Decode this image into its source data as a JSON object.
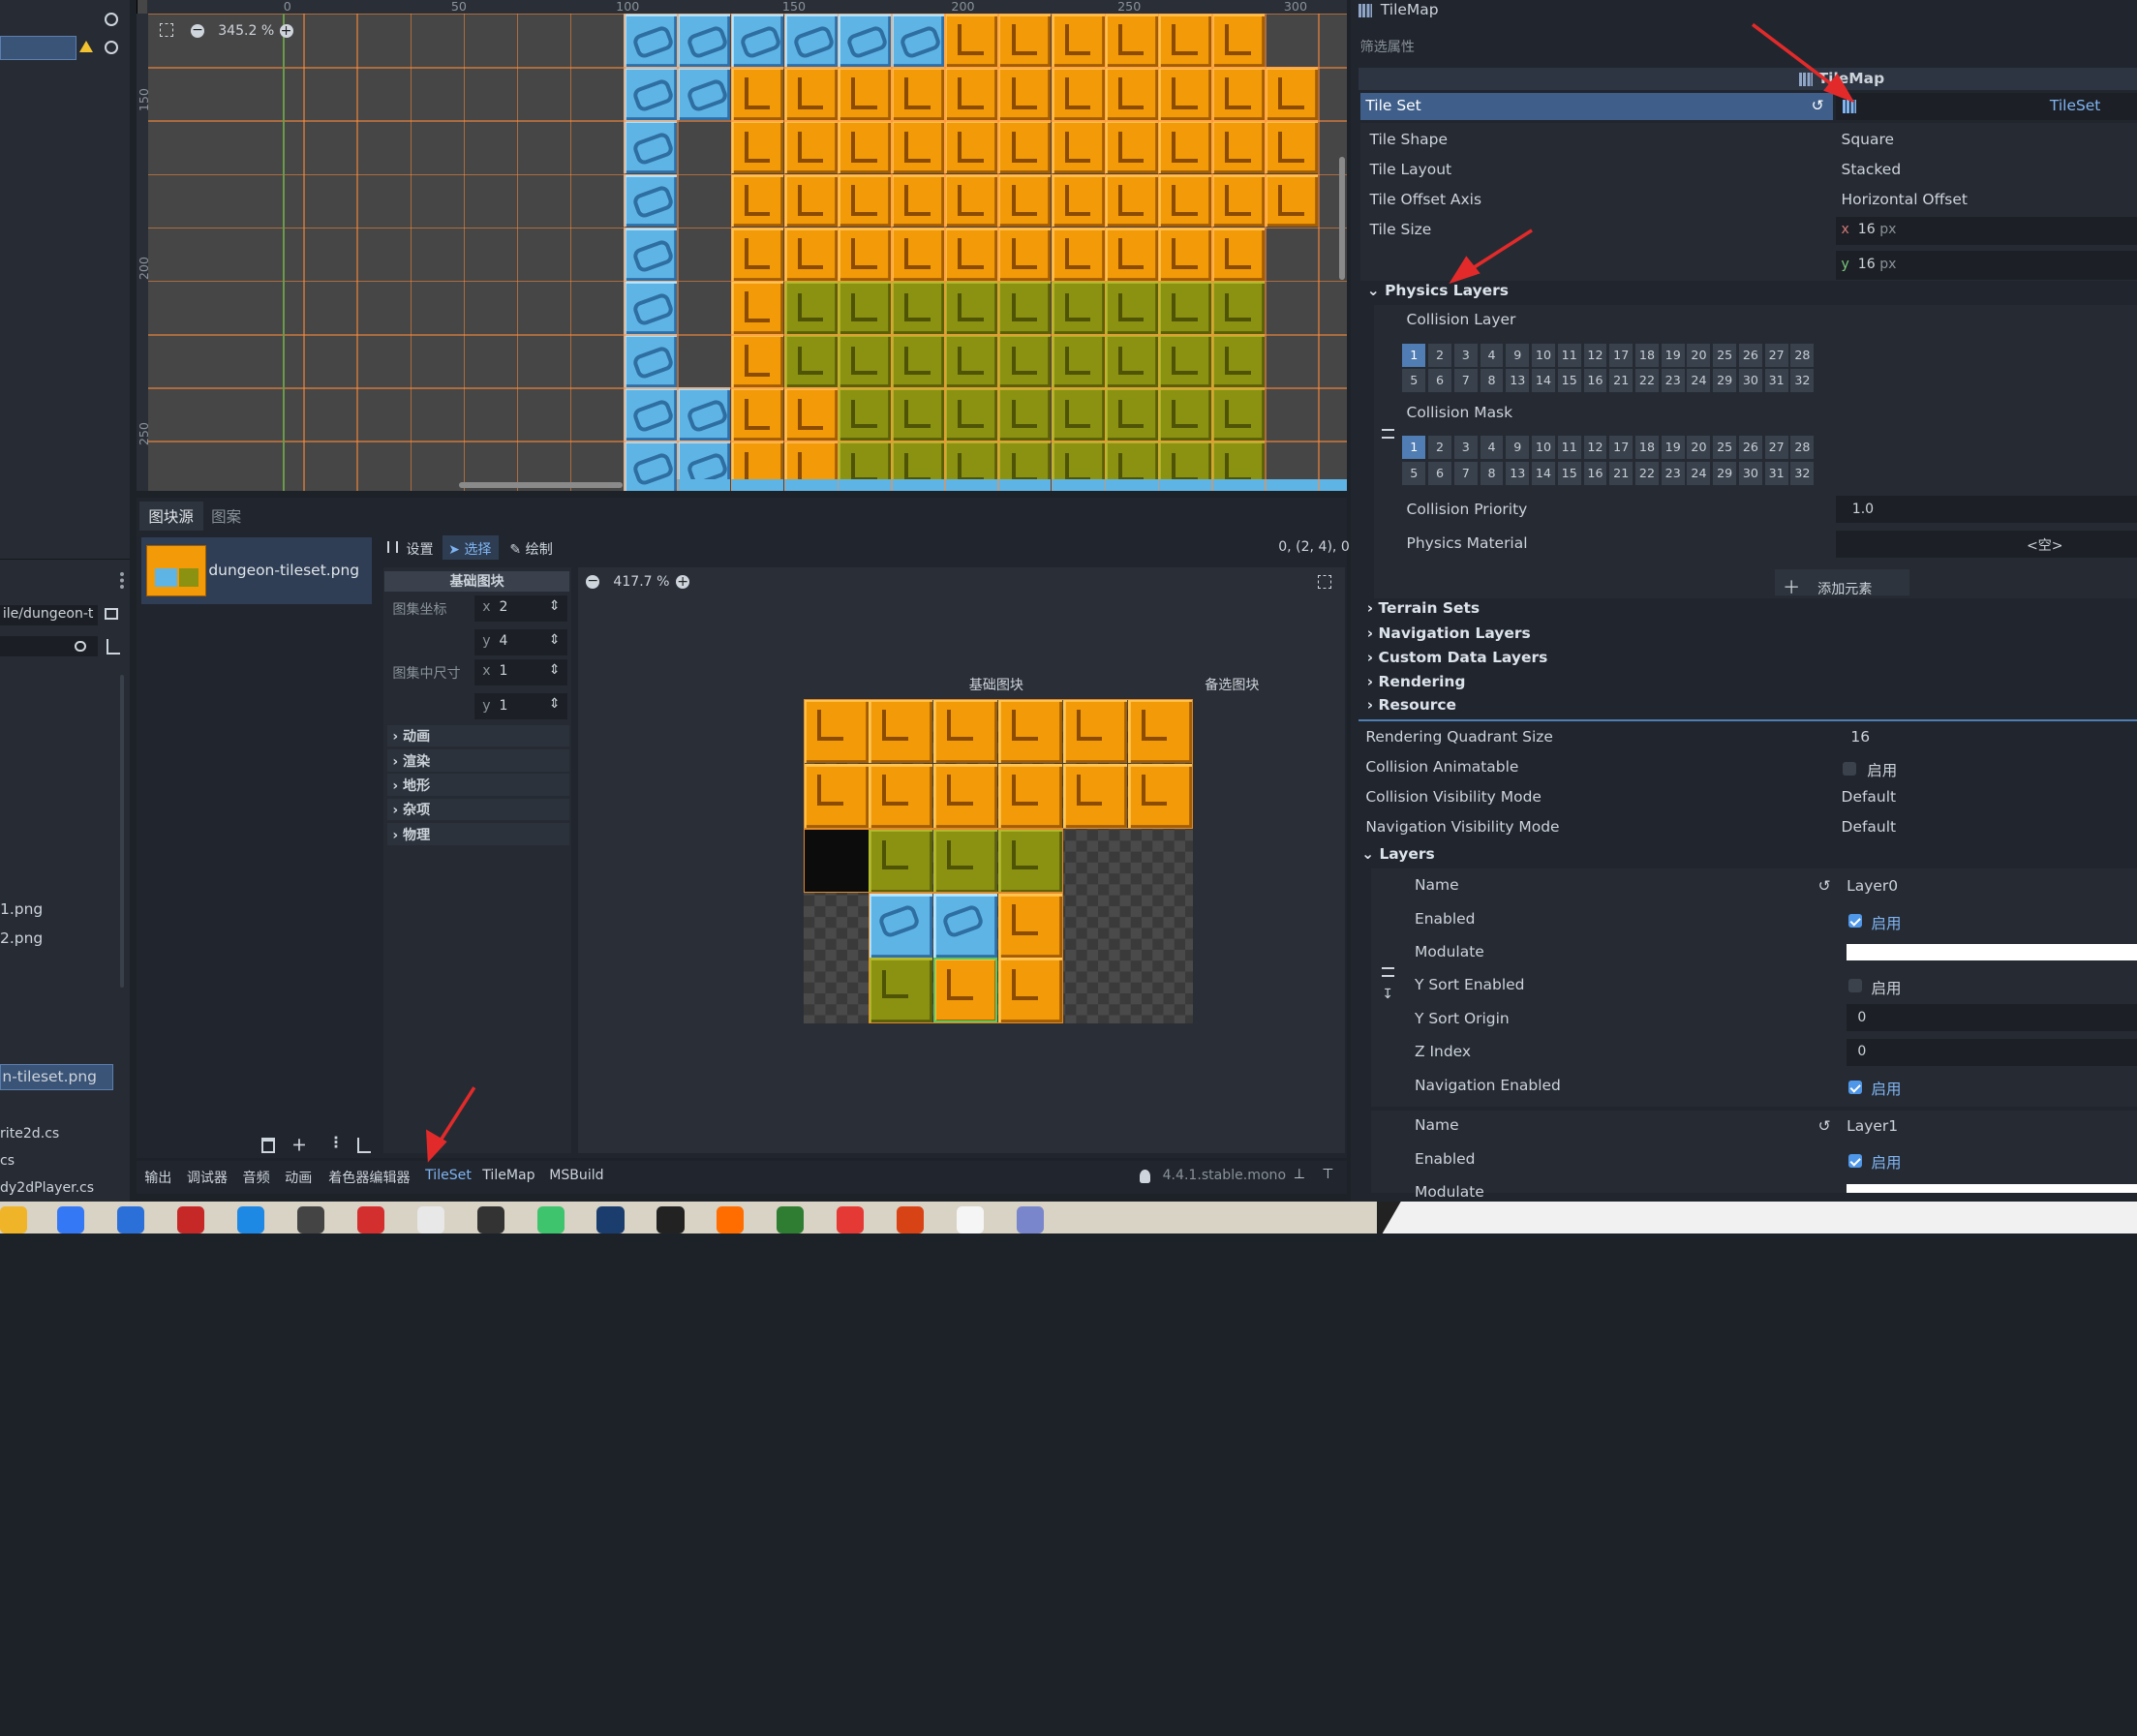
{
  "viewport": {
    "zoom": "345.2 %",
    "ruler_ticks": [
      "0",
      "50",
      "100",
      "150",
      "200",
      "250",
      "300"
    ],
    "vruler": [
      "150",
      "200",
      "250"
    ]
  },
  "bottom_panel": {
    "tabs": [
      "图块源",
      "图案"
    ],
    "source_item": "dungeon-tileset.png",
    "tools": [
      "设置",
      "选择",
      "绘制"
    ],
    "coords_readout": "0, (2, 4), 0",
    "inspector_title": "基础图块",
    "atlas_coords_label": "图集坐标",
    "atlas_x": "2",
    "atlas_y": "4",
    "size_label": "图集中尺寸",
    "size_x": "1",
    "size_y": "1",
    "sections": [
      "动画",
      "渲染",
      "地形",
      "杂项",
      "物理"
    ],
    "atlas_zoom": "417.7 %",
    "atlas_header_base": "基础图块",
    "atlas_header_alt": "备选图块"
  },
  "bottom_tabs": [
    "输出",
    "调试器",
    "音频",
    "动画",
    "着色器编辑器",
    "TileSet",
    "TileMap",
    "MSBuild"
  ],
  "version": "4.4.1.stable.mono",
  "left_files": {
    "path": "ile/dungeon-t",
    "files": [
      "1.png",
      "2.png",
      "n-tileset.png",
      "rite2d.cs",
      "cs",
      "dy2dPlayer.cs"
    ]
  },
  "inspector": {
    "title": "TileMap",
    "filter": "筛选属性",
    "class_header": "TileMap",
    "tile_set_label": "Tile Set",
    "tile_set_value": "TileSet",
    "props": [
      {
        "label": "Tile Shape",
        "value": "Square"
      },
      {
        "label": "Tile Layout",
        "value": "Stacked"
      },
      {
        "label": "Tile Offset Axis",
        "value": "Horizontal Offset"
      },
      {
        "label": "Tile Size",
        "value": ""
      }
    ],
    "tile_size_x": "16",
    "tile_size_y": "16",
    "unit": "px",
    "physics_layers": "Physics Layers",
    "collision_layer": "Collision Layer",
    "collision_mask": "Collision Mask",
    "collision_priority_label": "Collision Priority",
    "collision_priority": "1.0",
    "physics_material": "Physics Material",
    "physics_material_value": "<空>",
    "add_element": "添加元素",
    "collapsed": [
      "Terrain Sets",
      "Navigation Layers",
      "Custom Data Layers",
      "Rendering",
      "Resource"
    ],
    "rendering_quadrant_label": "Rendering Quadrant Size",
    "rendering_quadrant": "16",
    "collision_animatable": "Collision Animatable",
    "collision_vis": "Collision Visibility Mode",
    "collision_vis_value": "Default",
    "nav_vis": "Navigation Visibility Mode",
    "nav_vis_value": "Default",
    "on_label": "启用",
    "layers": "Layers",
    "layer_props": [
      "Name",
      "Enabled",
      "Modulate",
      "Y Sort Enabled",
      "Y Sort Origin",
      "Z Index",
      "Navigation Enabled"
    ],
    "layer0_name": "Layer0",
    "y_sort_origin": "0",
    "z_index": "0",
    "layer1_name": "Layer1",
    "layer1_props": [
      "Name",
      "Enabled",
      "Modulate"
    ]
  }
}
